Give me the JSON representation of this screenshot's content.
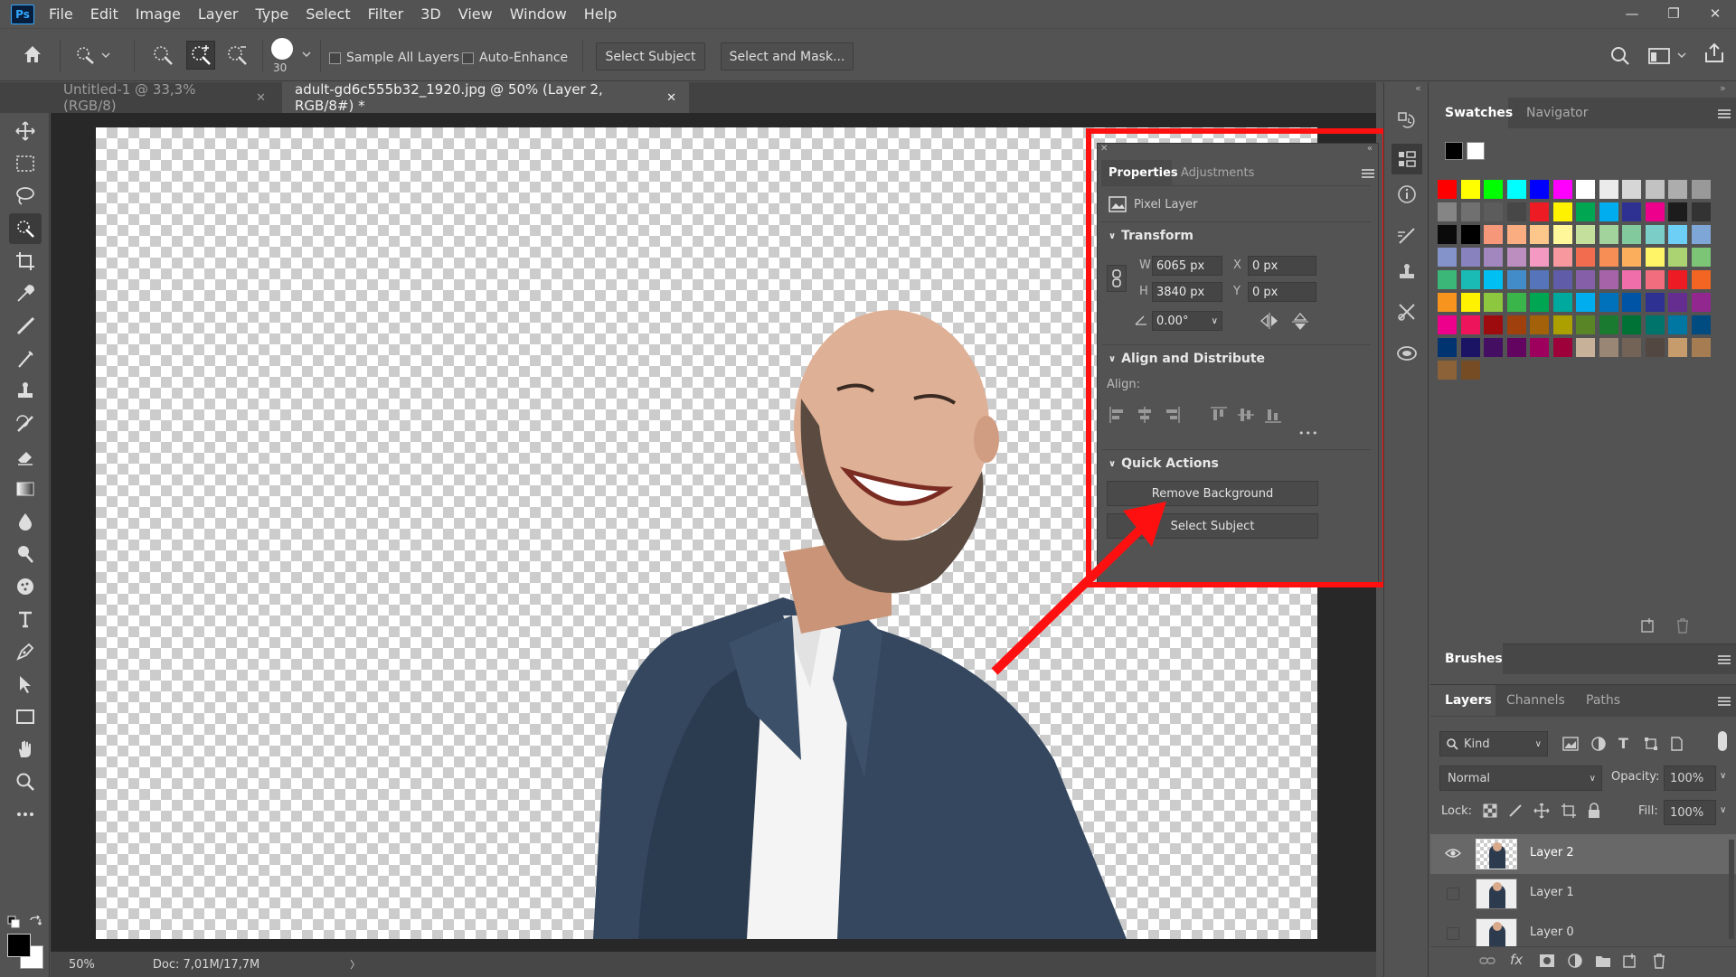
{
  "app": {
    "logo": "Ps"
  },
  "menu": [
    "File",
    "Edit",
    "Image",
    "Layer",
    "Type",
    "Select",
    "Filter",
    "3D",
    "View",
    "Window",
    "Help"
  ],
  "window_controls": {
    "minimize": "—",
    "restore": "❐",
    "close": "✕"
  },
  "options": {
    "brush_size": "30",
    "sample_all_layers": "Sample All Layers",
    "auto_enhance": "Auto-Enhance",
    "select_subject": "Select Subject",
    "select_and_mask": "Select and Mask..."
  },
  "doc_tabs": [
    {
      "label": "Untitled-1 @ 33,3% (RGB/8)",
      "close": "✕"
    },
    {
      "label": "adult-gd6c555b32_1920.jpg @ 50% (Layer 2, RGB/8#) *",
      "close": "✕"
    }
  ],
  "status": {
    "zoom": "50%",
    "doc": "Doc: 7,01M/17,7M",
    "arrow": "〉"
  },
  "properties": {
    "tabs": [
      "Properties",
      "Adjustments"
    ],
    "layer_type": "Pixel Layer",
    "transform": {
      "heading": "Transform",
      "w_label": "W",
      "w": "6065 px",
      "h_label": "H",
      "h": "3840 px",
      "x_label": "X",
      "x": "0 px",
      "y_label": "Y",
      "y": "0 px",
      "angle": "0.00°"
    },
    "align": {
      "heading": "Align and Distribute",
      "label": "Align:",
      "more": "•••"
    },
    "quick_actions": {
      "heading": "Quick Actions",
      "remove_bg": "Remove Background",
      "select_subject": "Select Subject"
    }
  },
  "right_panel": {
    "top_tabs": [
      "Swatches",
      "Navigator"
    ],
    "brushes_tab": "Brushes",
    "layer_tabs": [
      "Layers",
      "Channels",
      "Paths"
    ],
    "kind": "Kind",
    "blend_mode": "Normal",
    "opacity_label": "Opacity:",
    "opacity": "100%",
    "lock_label": "Lock:",
    "fill_label": "Fill:",
    "fill": "100%",
    "layers": [
      "Layer 2",
      "Layer 1",
      "Layer 0"
    ]
  },
  "colors": {
    "highlight_box": "#ff1010",
    "arrow": "#ff1010",
    "swatches": [
      [
        "#ff0000",
        "#ffff00",
        "#00ff00",
        "#00ffff",
        "#0000ff",
        "#ff00ff",
        "#ffffff",
        "#ebebeb",
        "#d6d6d6",
        "#c2c2c2",
        "#adadad",
        "#999999"
      ],
      [
        "#858585",
        "#707070",
        "#5c5c5c",
        "#474747",
        "#ed1c24",
        "#fff200",
        "#00a651",
        "#00aeef",
        "#2e3192",
        "#ec008c",
        "#1c1c1c",
        "#333333"
      ],
      [
        "#0a0a0a",
        "#000000",
        "#f7977a",
        "#f9ad81",
        "#fdc68a",
        "#fff79a",
        "#c4df9b",
        "#a3d39c",
        "#82ca9d",
        "#7bcdc8",
        "#6ecff6",
        "#7ea7d8"
      ],
      [
        "#8493ca",
        "#8882be",
        "#a187be",
        "#bc8dbf",
        "#f49ac2",
        "#f6989d",
        "#f26c4f",
        "#f68e55",
        "#fbaf5c",
        "#fff467",
        "#acd372",
        "#7cc576"
      ],
      [
        "#3bb878",
        "#1abbb4",
        "#00bff3",
        "#438cca",
        "#5574b9",
        "#605ca8",
        "#855fa8",
        "#a763a8",
        "#f06ea9",
        "#f26d7d",
        "#ed1c24",
        "#f26522"
      ],
      [
        "#f7941d",
        "#fff200",
        "#8dc73f",
        "#39b54a",
        "#00a651",
        "#00a99d",
        "#00aeef",
        "#0072bc",
        "#0054a6",
        "#2e3192",
        "#662d91",
        "#92278f"
      ],
      [
        "#ec008c",
        "#ed145b",
        "#9e0b0f",
        "#a0410d",
        "#a36209",
        "#aba000",
        "#598527",
        "#1a7b30",
        "#007236",
        "#00746b",
        "#0076a3",
        "#004b80"
      ],
      [
        "#003471",
        "#1b1464",
        "#440e62",
        "#630460",
        "#9e005d",
        "#9e0039",
        "#c7b299",
        "#998675",
        "#736357",
        "#534741",
        "#c69c6d",
        "#a67c52"
      ],
      [
        "#8c6239",
        "#754c24"
      ]
    ]
  }
}
